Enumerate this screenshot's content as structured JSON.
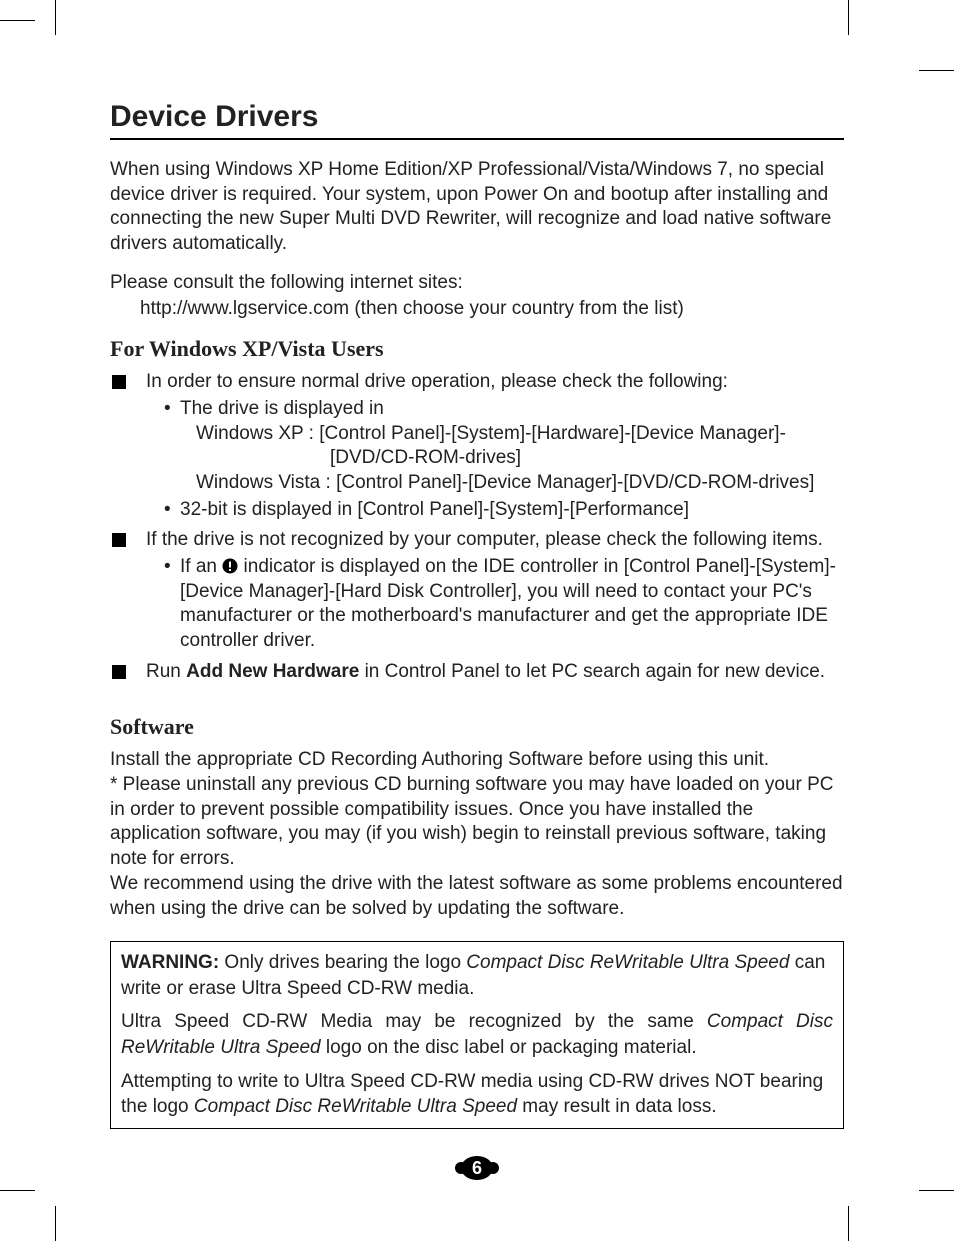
{
  "title": "Device Drivers",
  "intro": "When using Windows XP Home Edition/XP Professional/Vista/Windows 7, no special device driver is required. Your system, upon Power On and bootup after installing and connecting the new Super Multi DVD Rewriter, will recognize and load native software drivers automatically.",
  "consult_intro": "Please consult the following internet sites:",
  "consult_url": "http://www.lgservice.com (then choose your country from the list)",
  "sub1_heading": "For Windows XP/Vista Users",
  "sq1_intro": "In order to ensure normal drive operation, please check the following:",
  "sq1_b1_a": "The drive is displayed in",
  "sq1_b1_b": "Windows XP : [Control Panel]-[System]-[Hardware]-[Device Manager]-",
  "sq1_b1_c": "[DVD/CD-ROM-drives]",
  "sq1_b1_d": "Windows Vista : [Control Panel]-[Device Manager]-[DVD/CD-ROM-drives]",
  "sq1_b2": "32-bit is displayed in [Control Panel]-[System]-[Performance]",
  "sq2_intro": "If the drive is not recognized by your computer, please check the following items.",
  "sq2_b1_a": "If an ",
  "sq2_b1_b": " indicator is displayed on the IDE controller in [Control Panel]-[System]-[Device Manager]-[Hard Disk Controller], you will need to contact your PC's manufacturer or the motherboard's manufacturer and get the appropriate IDE controller driver.",
  "sq3_a": "Run ",
  "sq3_b": "Add New Hardware",
  "sq3_c": " in Control Panel to let PC search again for new device.",
  "sub2_heading": "Software",
  "soft_p1": "Install the appropriate CD Recording Authoring Software before using this unit.",
  "soft_p2": "* Please uninstall any previous CD burning software you may have loaded on your PC in order to prevent possible compatibility issues. Once you have installed the application software, you may (if you wish) begin to reinstall previous software, taking note for errors.",
  "soft_p3": "We recommend using the drive with the latest software as some problems encountered when using the drive can be solved by updating the software.",
  "warn_label": "WARNING:",
  "warn_p1_a": " Only drives bearing the logo ",
  "warn_p1_i": "Compact Disc ReWritable Ultra Speed",
  "warn_p1_b": " can write or erase Ultra Speed CD-RW media.",
  "warn_p2_a": "Ultra Speed CD-RW Media may be recognized by the same ",
  "warn_p2_i": "Compact Disc ReWritable Ultra Speed",
  "warn_p2_b": " logo on the disc label or packaging material.",
  "warn_p3_a": "Attempting to write to Ultra Speed CD-RW media using CD-RW drives NOT bearing the logo ",
  "warn_p3_i": "Compact Disc ReWritable Ultra Speed",
  "warn_p3_b": " may result in data loss.",
  "page_number": "6"
}
